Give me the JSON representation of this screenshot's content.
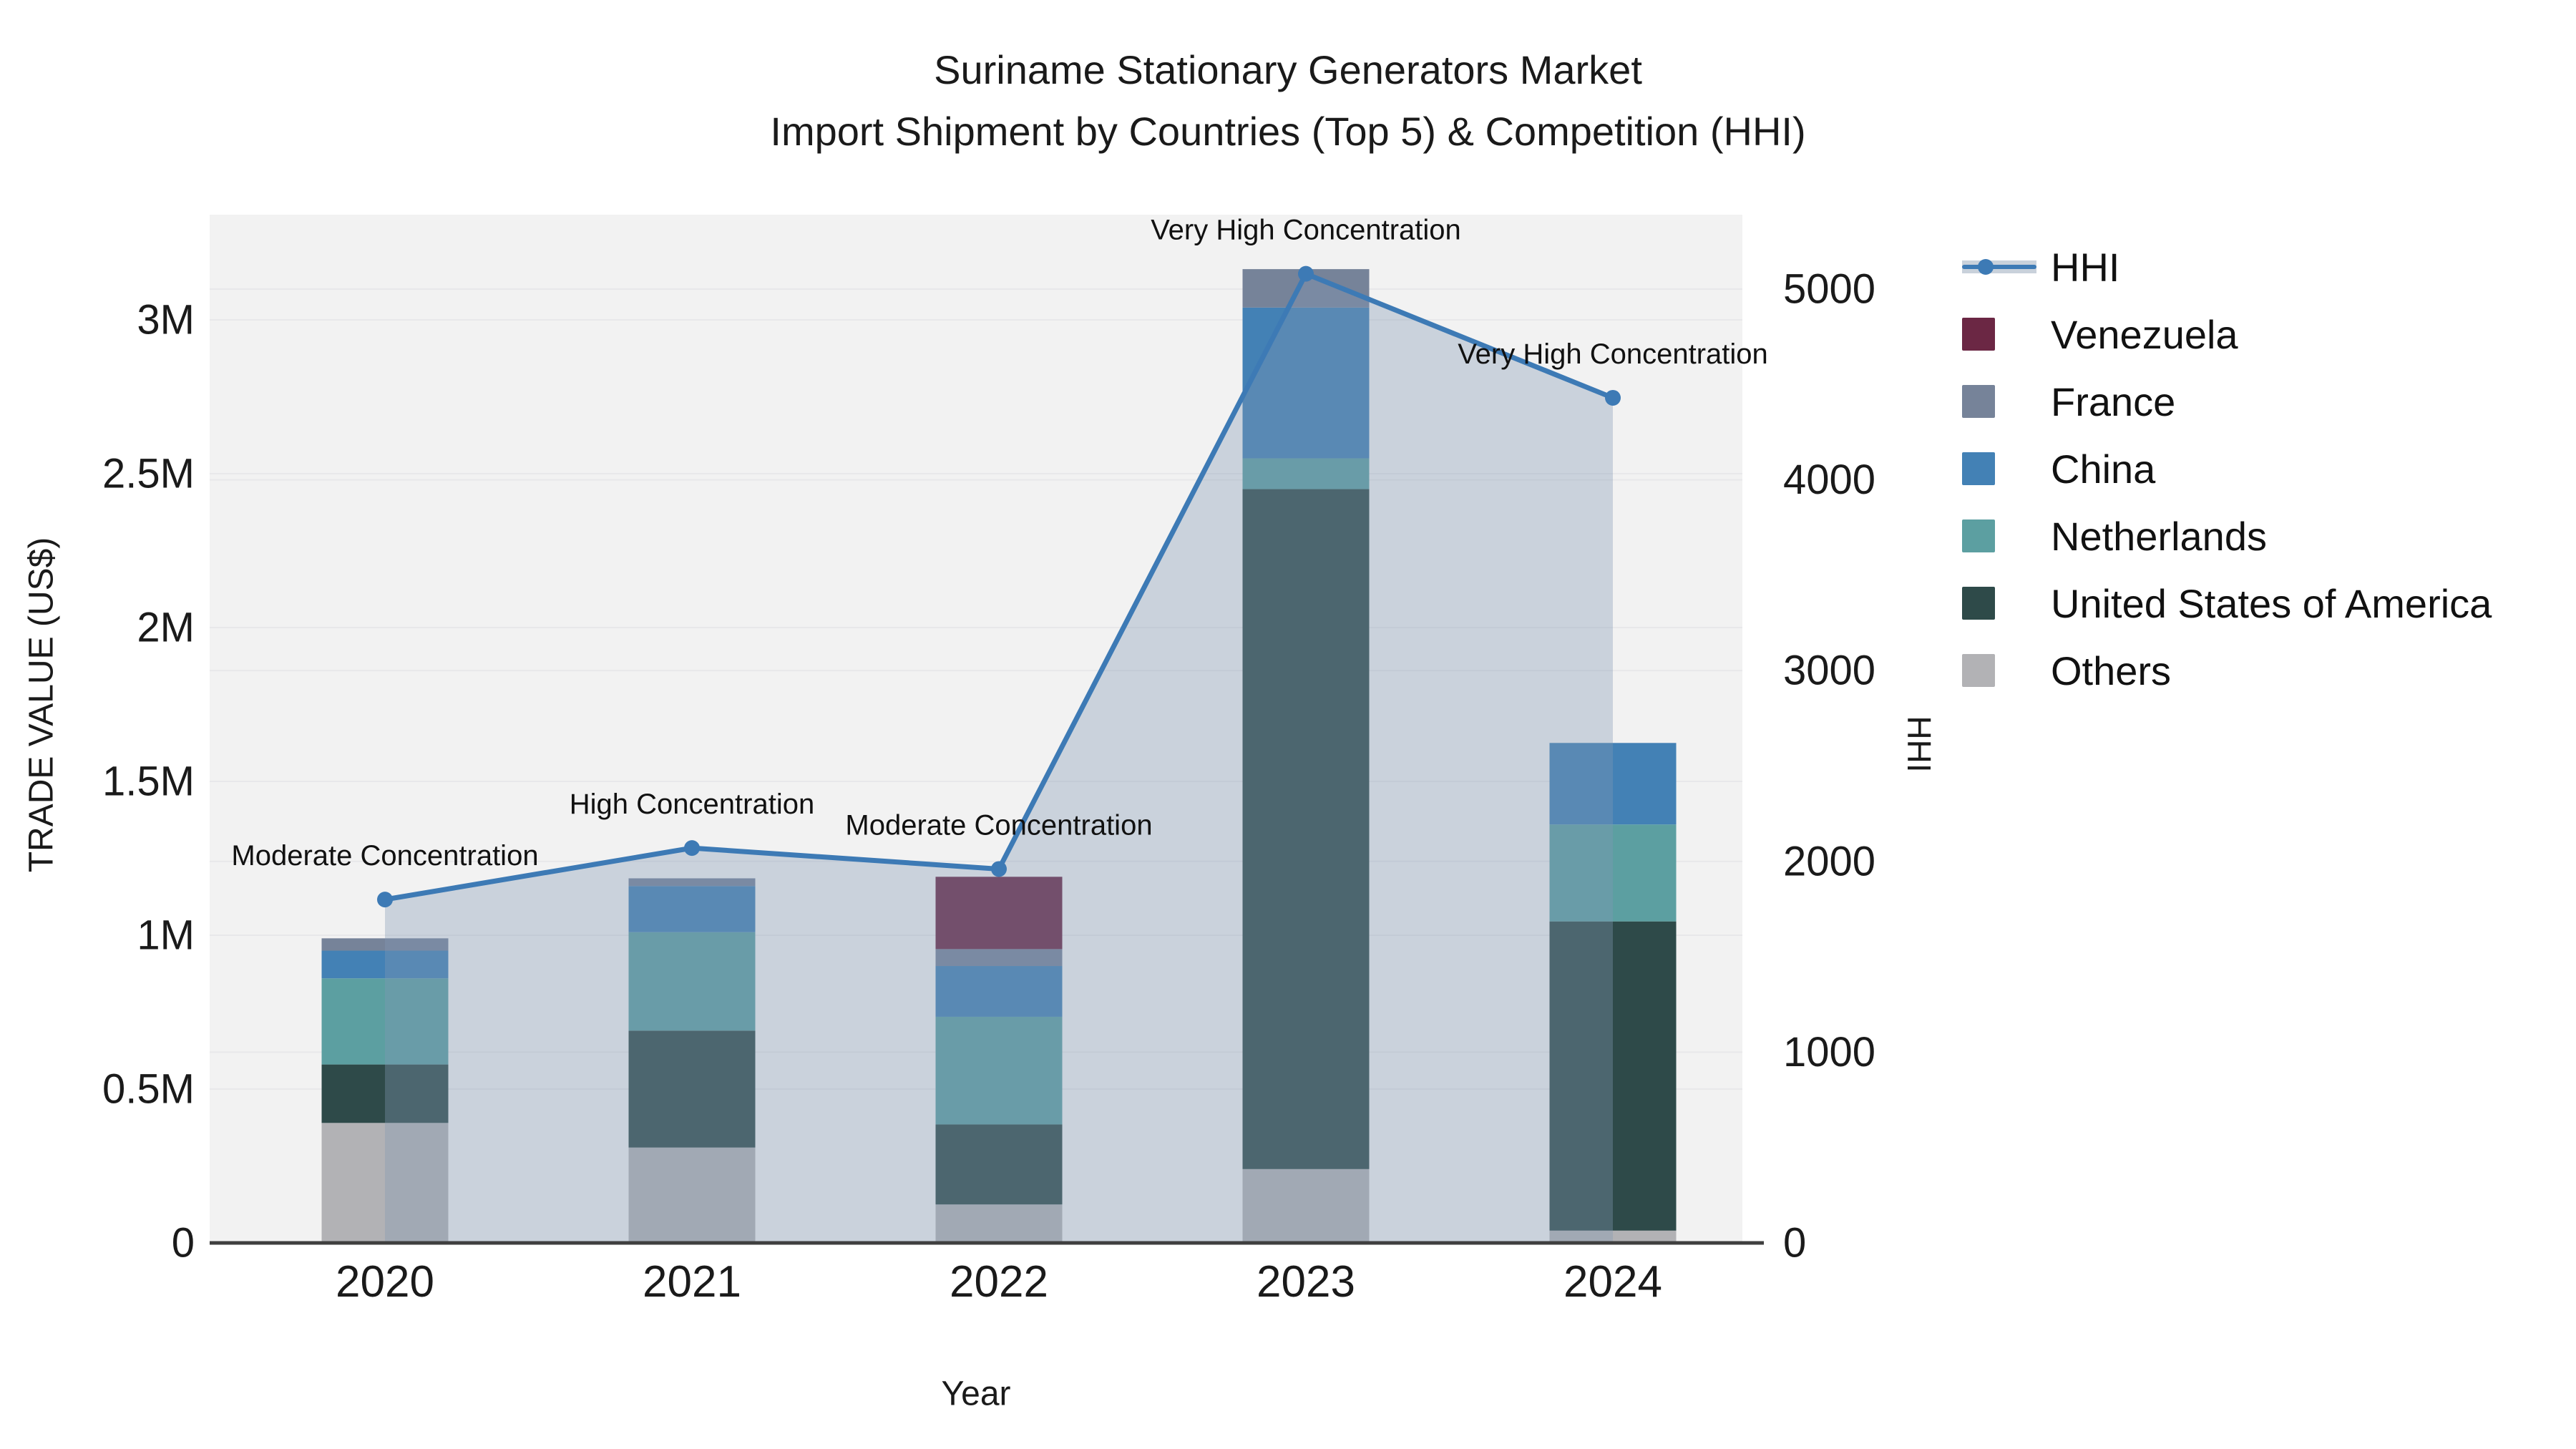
{
  "title": {
    "line1": "Suriname Stationary Generators Market",
    "line2": "Import Shipment by Countries (Top 5) & Competition (HHI)"
  },
  "axes": {
    "left": {
      "title": "TRADE VALUE (US$)",
      "ticks": [
        {
          "label": "0",
          "value": 0
        },
        {
          "label": "0.5M",
          "value": 500000
        },
        {
          "label": "1M",
          "value": 1000000
        },
        {
          "label": "1.5M",
          "value": 1500000
        },
        {
          "label": "2M",
          "value": 2000000
        },
        {
          "label": "2.5M",
          "value": 2500000
        },
        {
          "label": "3M",
          "value": 3000000
        }
      ]
    },
    "right": {
      "title": "HHI",
      "ticks": [
        {
          "label": "0",
          "value": 0
        },
        {
          "label": "1000",
          "value": 1000
        },
        {
          "label": "2000",
          "value": 2000
        },
        {
          "label": "3000",
          "value": 3000
        },
        {
          "label": "4000",
          "value": 4000
        },
        {
          "label": "5000",
          "value": 5000
        }
      ]
    },
    "x": {
      "title": "Year",
      "labels": [
        "2020",
        "2021",
        "2022",
        "2023",
        "2024"
      ]
    }
  },
  "legend": {
    "items": [
      {
        "label": "HHI",
        "color": "#3d7ab5",
        "type": "line"
      },
      {
        "label": "Venezuela",
        "color": "#6B2744",
        "type": "box"
      },
      {
        "label": "France",
        "color": "#768399",
        "type": "box"
      },
      {
        "label": "China",
        "color": "#4381B5",
        "type": "box"
      },
      {
        "label": "Netherlands",
        "color": "#5C9FA1",
        "type": "box"
      },
      {
        "label": "United States of America",
        "color": "#2E4A49",
        "type": "box"
      },
      {
        "label": "Others",
        "color": "#B2B2B5",
        "type": "box"
      }
    ]
  },
  "chart_data": {
    "type": "bar+line",
    "title": "Suriname Stationary Generators Market — Import Shipment by Countries (Top 5) & Competition (HHI)",
    "x": [
      2020,
      2021,
      2022,
      2023,
      2024
    ],
    "bar_unit": "US$",
    "stack_order_bottom_to_top": [
      "Others",
      "United States of America",
      "Netherlands",
      "China",
      "France",
      "Venezuela"
    ],
    "series": [
      {
        "name": "Venezuela",
        "color": "#6B2744",
        "values": [
          0,
          0,
          235000,
          0,
          0
        ]
      },
      {
        "name": "France",
        "color": "#768399",
        "values": [
          40000,
          25000,
          55000,
          125000,
          0
        ]
      },
      {
        "name": "China",
        "color": "#4381B5",
        "values": [
          90000,
          150000,
          165000,
          490000,
          265000
        ]
      },
      {
        "name": "Netherlands",
        "color": "#5C9FA1",
        "values": [
          280000,
          320000,
          350000,
          100000,
          315000
        ]
      },
      {
        "name": "United States of America",
        "color": "#2E4A49",
        "values": [
          190000,
          380000,
          260000,
          2210000,
          1005000
        ]
      },
      {
        "name": "Others",
        "color": "#B2B2B5",
        "values": [
          390000,
          310000,
          125000,
          240000,
          40000
        ]
      }
    ],
    "bar_totals": [
      990000,
      1185000,
      1190000,
      3165000,
      1625000
    ],
    "line_series": {
      "name": "HHI",
      "axis": "right",
      "color": "#3d7ab5",
      "area_fill": "rgba(130,152,180,0.36)",
      "values": [
        1800,
        2070,
        1960,
        5080,
        4430
      ]
    },
    "annotations": [
      {
        "x": 2020,
        "text": "Moderate Concentration"
      },
      {
        "x": 2021,
        "text": "High Concentration"
      },
      {
        "x": 2022,
        "text": "Moderate Concentration"
      },
      {
        "x": 2023,
        "text": "Very High Concentration"
      },
      {
        "x": 2024,
        "text": "Very High Concentration"
      }
    ],
    "xlabel": "Year",
    "ylabel_left": "TRADE VALUE (US$)",
    "ylabel_right": "HHI",
    "ylim_left": [
      0,
      3342000
    ],
    "ylim_right": [
      0,
      5390
    ],
    "grid": true,
    "legend_position": "right"
  },
  "colors": {
    "figure_bg": "#ffffff",
    "plot_bg": "#f2f2f2",
    "grid": "#e8e8ea",
    "axis_line": "#3f3f3f",
    "text": "#1a1a1a",
    "hhi_line": "#3d7ab5",
    "area_fill": "rgba(130,152,180,0.36)"
  }
}
